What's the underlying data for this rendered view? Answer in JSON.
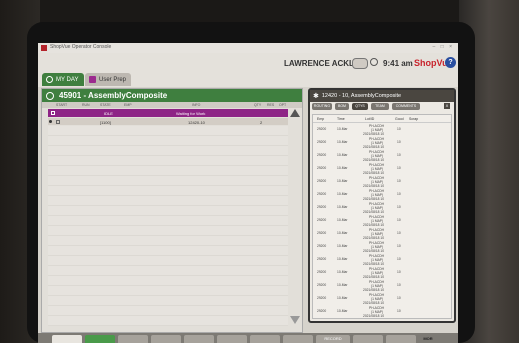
{
  "window": {
    "title": "ShopVue Operator Console",
    "controls": "– □ ×"
  },
  "header": {
    "tabs": [
      {
        "label": "MY DAY"
      },
      {
        "label": "User Prep"
      }
    ],
    "user": "LAWRENCE ACKLIN",
    "time": "9:41 am",
    "brand": "ShopVue",
    "help": "?"
  },
  "left_panel": {
    "title": "45901 - AssemblyComposite",
    "columns": [
      "START",
      "RUN",
      "STATE",
      "EMP",
      "INFO",
      "QTY",
      "RES",
      "OPT"
    ],
    "rows": [
      {
        "state": "IDLE",
        "info": "Waiting for Work",
        "qty": ""
      },
      {
        "state": "[1100]",
        "info": "12420-10",
        "qty": "2"
      }
    ]
  },
  "right_panel": {
    "title": "12420 - 10, AssemblyComposite",
    "tabs": [
      "ROUTING",
      "BOM",
      "QTYS",
      "TEAM",
      "COMMENTS"
    ],
    "close": "X",
    "columns": [
      "Emp",
      "Time",
      "Lot/ID",
      "Good",
      "Scrap"
    ],
    "rows": [
      {
        "emp": "29200",
        "time": "10-Mar",
        "lot1": "PH-ACDH",
        "lot2": "(1 MAP)",
        "lot3": "2021/08/18 10",
        "good": "10"
      },
      {
        "emp": "29200",
        "time": "10-Mar",
        "lot1": "PH-ACDH",
        "lot2": "(1 MAP)",
        "lot3": "2021/08/18 10",
        "good": "10"
      },
      {
        "emp": "29200",
        "time": "10-Mar",
        "lot1": "PH-ACDH",
        "lot2": "(1 MAP)",
        "lot3": "2021/08/18 10",
        "good": "10"
      },
      {
        "emp": "29200",
        "time": "10-Mar",
        "lot1": "PH-ACDH",
        "lot2": "(1 MAP)",
        "lot3": "2021/08/18 10",
        "good": "10"
      },
      {
        "emp": "29200",
        "time": "10-Mar",
        "lot1": "PH-ACDH",
        "lot2": "(1 MAP)",
        "lot3": "2021/08/18 10",
        "good": "10"
      },
      {
        "emp": "29200",
        "time": "10-Mar",
        "lot1": "PH-ACDH",
        "lot2": "(1 MAP)",
        "lot3": "2021/08/18 10",
        "good": "10"
      },
      {
        "emp": "29200",
        "time": "10-Mar",
        "lot1": "PH-ACDH",
        "lot2": "(1 MAP)",
        "lot3": "2021/08/18 10",
        "good": "10"
      },
      {
        "emp": "29200",
        "time": "10-Mar",
        "lot1": "PH-ACDH",
        "lot2": "(1 MAP)",
        "lot3": "2021/08/18 10",
        "good": "10"
      },
      {
        "emp": "29200",
        "time": "10-Mar",
        "lot1": "PH-ACDH",
        "lot2": "(1 MAP)",
        "lot3": "2021/08/18 10",
        "good": "10"
      },
      {
        "emp": "29200",
        "time": "10-Mar",
        "lot1": "PH-ACDH",
        "lot2": "(1 MAP)",
        "lot3": "2021/08/18 10",
        "good": "10"
      },
      {
        "emp": "29200",
        "time": "10-Mar",
        "lot1": "PH-ACDH",
        "lot2": "(1 MAP)",
        "lot3": "2021/08/18 10",
        "good": "10"
      },
      {
        "emp": "29200",
        "time": "10-Mar",
        "lot1": "PH-ACDH",
        "lot2": "(1 MAP)",
        "lot3": "2021/08/18 10",
        "good": "10"
      },
      {
        "emp": "29200",
        "time": "10-Mar",
        "lot1": "PH-ACDH",
        "lot2": "(1 MAP)",
        "lot3": "2021/08/18 10",
        "good": "10"
      },
      {
        "emp": "29200",
        "time": "10-Mar",
        "lot1": "PH-ACDH",
        "lot2": "(1 MAP)",
        "lot3": "2021/08/18 10",
        "good": "10"
      },
      {
        "emp": "29200",
        "time": "10-Mar",
        "lot1": "PH-ACDH",
        "lot2": "(1 MAP)",
        "lot3": "2021/08/18 10",
        "good": "10"
      }
    ]
  },
  "bottom_bar": {
    "buttons": [
      "",
      "",
      "",
      "",
      "",
      "",
      "",
      "",
      "RECORD",
      "",
      "",
      ""
    ],
    "corner": "MOR"
  },
  "colors": {
    "green": "#3f7f3f",
    "purple": "#8e2486",
    "brand_red": "#c8232c",
    "help_blue": "#2a4fa0"
  }
}
